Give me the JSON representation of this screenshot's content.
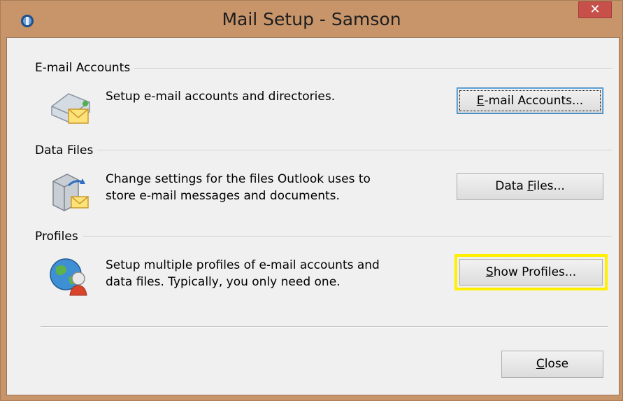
{
  "window": {
    "title": "Mail Setup - Samson",
    "close_glyph": "✕"
  },
  "sections": {
    "email_accounts": {
      "heading": "E-mail Accounts",
      "description": "Setup e-mail accounts and directories.",
      "button": {
        "prefix": "",
        "mnemonic": "E",
        "suffix": "-mail Accounts..."
      },
      "icon": "email-accounts-icon"
    },
    "data_files": {
      "heading": "Data Files",
      "description_line1": "Change settings for the files Outlook uses to",
      "description_line2": "store e-mail messages and documents.",
      "button": {
        "prefix": "Data ",
        "mnemonic": "F",
        "suffix": "iles..."
      },
      "icon": "data-files-icon"
    },
    "profiles": {
      "heading": "Profiles",
      "description_line1": "Setup multiple profiles of e-mail accounts and",
      "description_line2": "data files. Typically, you only need one.",
      "button": {
        "prefix": "",
        "mnemonic": "S",
        "suffix": "how Profiles..."
      },
      "icon": "profiles-globe-icon",
      "highlight_color": "#ffef00"
    }
  },
  "footer": {
    "close_button": {
      "prefix": "",
      "mnemonic": "C",
      "suffix": "lose"
    }
  },
  "colors": {
    "titlebar": "#c8956b",
    "close": "#c7504a",
    "client": "#f0f0f0"
  }
}
